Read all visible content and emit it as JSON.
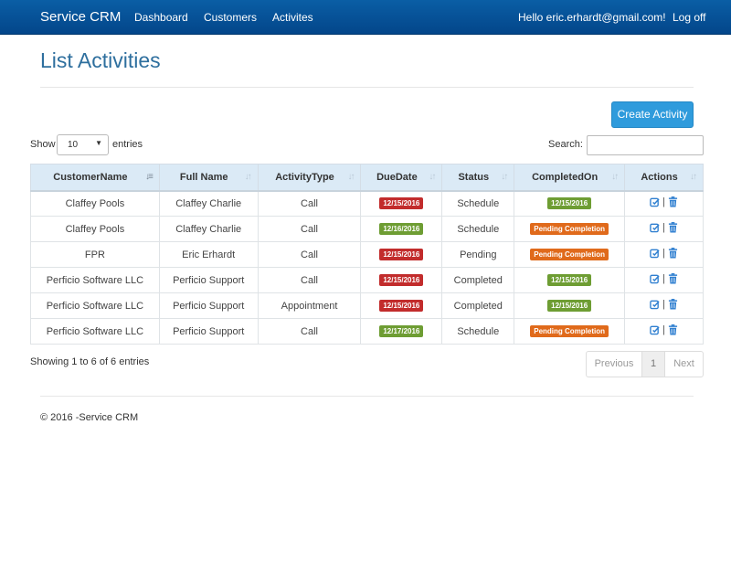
{
  "nav": {
    "brand": "Service CRM",
    "links": [
      "Dashboard",
      "Customers",
      "Activites"
    ],
    "greeting": "Hello eric.erhardt@gmail.com!",
    "logoff": "Log off",
    "bar_color": "#0a5ea5"
  },
  "page": {
    "title": "List Activities",
    "create_button": "Create Activity"
  },
  "controls": {
    "show_label": "Show",
    "page_length": "10",
    "entries_label": "entries",
    "search_label": "Search:",
    "search_value": ""
  },
  "table": {
    "headers": [
      "CustomerName",
      "Full Name",
      "ActivityType",
      "DueDate",
      "Status",
      "CompletedOn",
      "Actions"
    ],
    "sorted_column": "CustomerName",
    "rows": [
      {
        "customer": "Claffey Pools",
        "full_name": "Claffey Charlie",
        "type": "Call",
        "due": "12/15/2016",
        "due_color": "red",
        "status": "Schedule",
        "completed": "12/15/2016",
        "completed_color": "green"
      },
      {
        "customer": "Claffey Pools",
        "full_name": "Claffey Charlie",
        "type": "Call",
        "due": "12/16/2016",
        "due_color": "green",
        "status": "Schedule",
        "completed": "Pending Completion",
        "completed_color": "orange"
      },
      {
        "customer": "FPR",
        "full_name": "Eric Erhardt",
        "type": "Call",
        "due": "12/15/2016",
        "due_color": "red",
        "status": "Pending",
        "completed": "Pending Completion",
        "completed_color": "orange"
      },
      {
        "customer": "Perficio Software LLC",
        "full_name": "Perficio Support",
        "type": "Call",
        "due": "12/15/2016",
        "due_color": "red",
        "status": "Completed",
        "completed": "12/15/2016",
        "completed_color": "green"
      },
      {
        "customer": "Perficio Software LLC",
        "full_name": "Perficio Support",
        "type": "Appointment",
        "due": "12/15/2016",
        "due_color": "red",
        "status": "Completed",
        "completed": "12/15/2016",
        "completed_color": "green"
      },
      {
        "customer": "Perficio Software LLC",
        "full_name": "Perficio Support",
        "type": "Call",
        "due": "12/17/2016",
        "due_color": "green",
        "status": "Schedule",
        "completed": "Pending Completion",
        "completed_color": "orange"
      }
    ],
    "action_icons": [
      "edit-icon",
      "trash-icon"
    ],
    "action_separator": "|"
  },
  "pagination": {
    "info": "Showing 1 to 6 of 6 entries",
    "previous": "Previous",
    "current_page": "1",
    "next": "Next"
  },
  "footer": {
    "text": "© 2016 -Service CRM"
  },
  "colors": {
    "title": "#2e6f9e",
    "create_button": "#2f9bdc",
    "header_row": "#dbeaf6",
    "badge_red": "#c22c2c",
    "badge_green": "#6e9d33",
    "badge_orange": "#e06a1b"
  }
}
